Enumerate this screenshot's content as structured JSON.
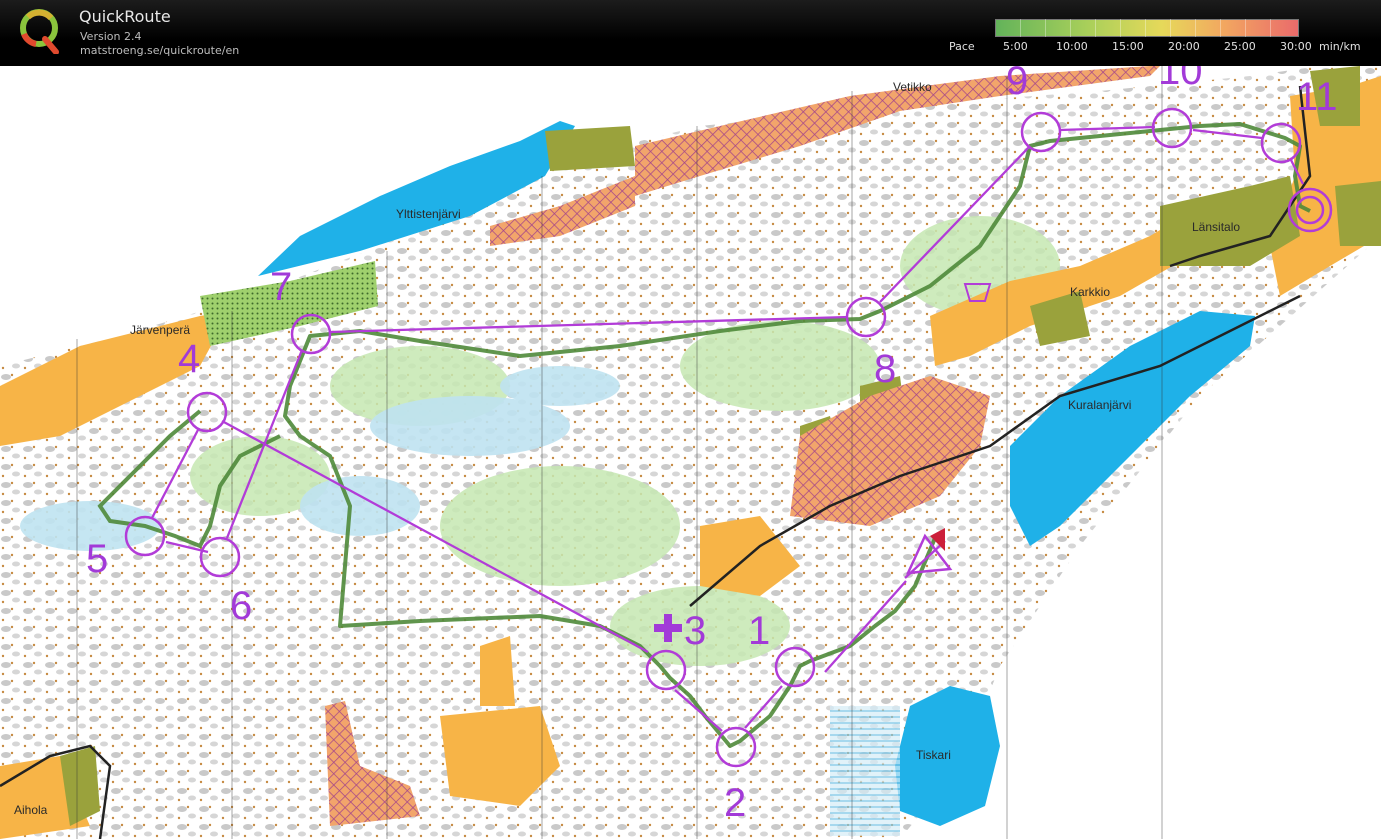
{
  "app": {
    "title": "QuickRoute",
    "version": "Version 2.4",
    "url": "matstroeng.se/quickroute/en"
  },
  "pace_scale": {
    "label": "Pace",
    "ticks": [
      "5:00",
      "10:00",
      "15:00",
      "20:00",
      "25:00",
      "30:00"
    ],
    "unit": "min/km"
  },
  "map": {
    "place_names": {
      "ylttistenjarvi": "Ylttistenjärvi",
      "jarvenpera": "Järvenperä",
      "vetikko": "Vetikko",
      "lansitalo": "Länsitalo",
      "karkkio": "Karkkio",
      "kuralanjarvi": "Kuralanjärvi",
      "tiskari": "Tiskari",
      "aihola": "Aihola"
    },
    "control_numbers": [
      "1",
      "2",
      "3",
      "4",
      "5",
      "6",
      "7",
      "8",
      "9",
      "10",
      "11"
    ],
    "colors": {
      "course": "#b23cd8",
      "route": "#4f8a3a",
      "water": "#1fb1e8",
      "open": "#f7b447",
      "green": "#9dd37a"
    }
  }
}
